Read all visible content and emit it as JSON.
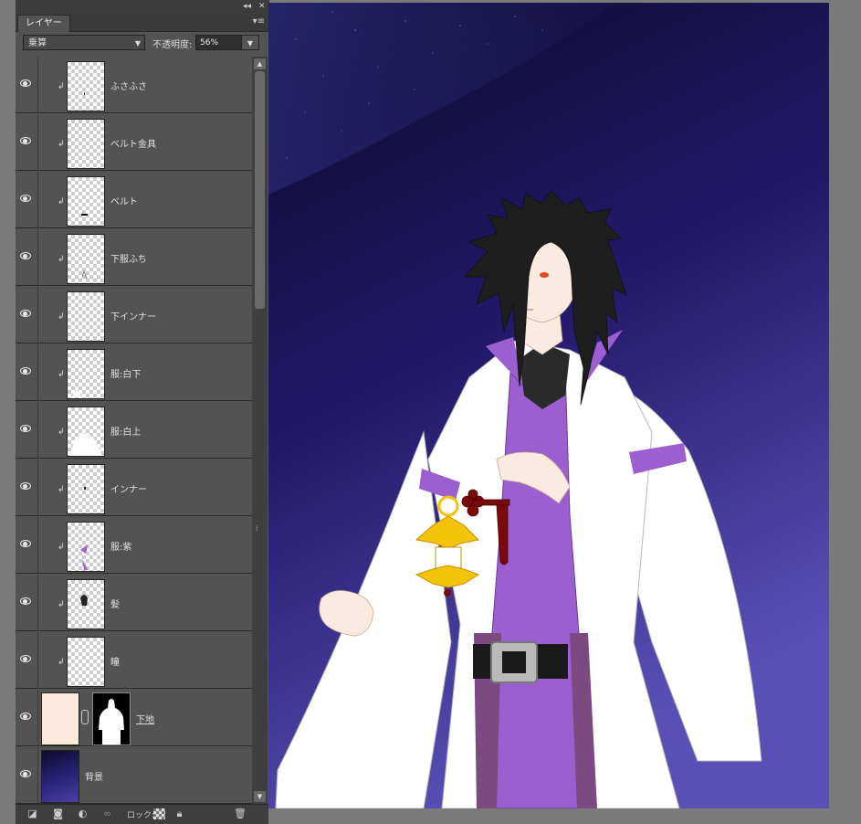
{
  "panel": {
    "tab_label": "レイヤー",
    "collapse_glyph": "◂◂",
    "close_glyph": "✕",
    "menu_glyph": "▾≡",
    "blend_mode": "乗算",
    "opacity_label": "不透明度:",
    "opacity_value": "56%",
    "lock_label": "ロック:"
  },
  "layers": [
    {
      "name": "ふさふさ",
      "visible": true,
      "clipped": true
    },
    {
      "name": "ベルト金具",
      "visible": true,
      "clipped": true
    },
    {
      "name": "ベルト",
      "visible": true,
      "clipped": true
    },
    {
      "name": "下服ふち",
      "visible": true,
      "clipped": true
    },
    {
      "name": "下インナー",
      "visible": true,
      "clipped": true
    },
    {
      "name": "服:白下",
      "visible": true,
      "clipped": true
    },
    {
      "name": "服:白上",
      "visible": true,
      "clipped": true
    },
    {
      "name": "インナー",
      "visible": true,
      "clipped": true
    },
    {
      "name": "服:紫",
      "visible": true,
      "clipped": true
    },
    {
      "name": "髪",
      "visible": true,
      "clipped": true
    },
    {
      "name": "瞳",
      "visible": true,
      "clipped": true
    },
    {
      "name": "下地",
      "visible": true,
      "clipped": false
    },
    {
      "name": "背景",
      "visible": true,
      "clipped": false
    }
  ],
  "icons": [
    "eye-icon",
    "link-layers-icon",
    "add-mask-icon",
    "adjustment-icon",
    "lock-transparency-icon",
    "lock-all-icon",
    "trash-icon"
  ],
  "colors": {
    "panel_bg": "#535353",
    "sky_top": "#0c0a2a",
    "sky_bottom": "#5a4fb5",
    "robe_white": "#ffffff",
    "robe_purple": "#9b5fd0",
    "lantern_gold": "#f5c20a",
    "hair": "#1e1e1e"
  }
}
